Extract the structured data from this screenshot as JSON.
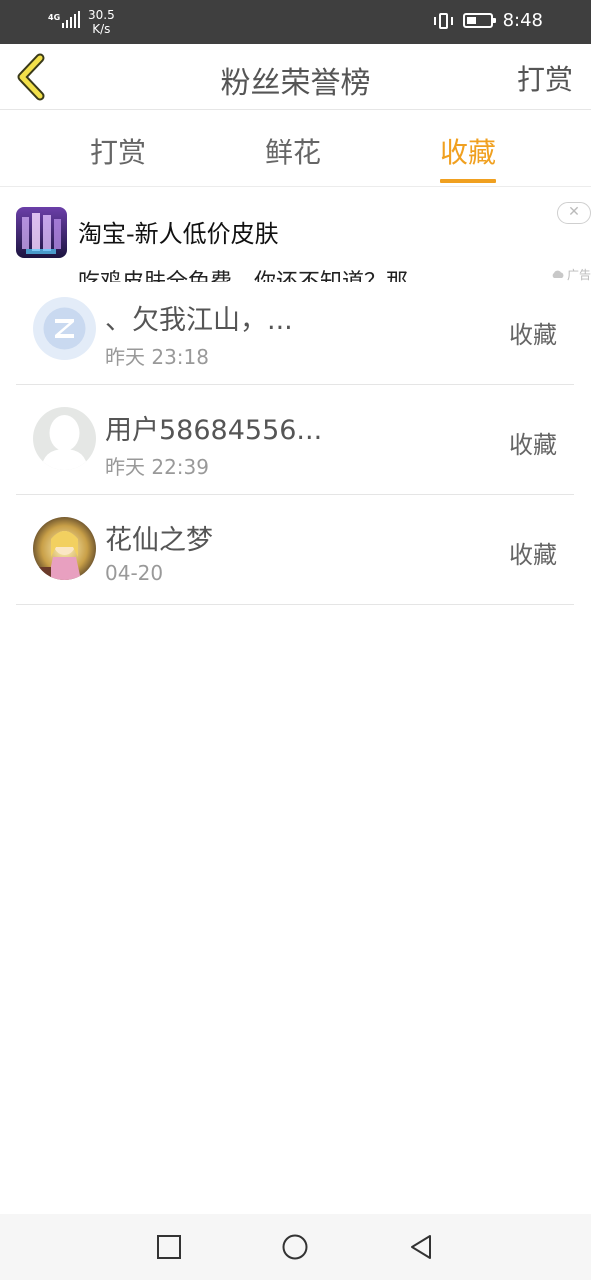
{
  "status_bar": {
    "network_type": "4G",
    "speed_value": "30.5",
    "speed_unit": "K/s",
    "battery_level": 0.4,
    "time": "8:48",
    "icons": [
      "signal-icon",
      "vibrate-icon",
      "battery-icon"
    ]
  },
  "header": {
    "title": "粉丝荣誉榜",
    "action_label": "打赏",
    "back_icon": "chevron-left-icon",
    "accent_color": "#f0a020"
  },
  "tabs": [
    {
      "label": "打赏",
      "active": false
    },
    {
      "label": "鲜花",
      "active": false
    },
    {
      "label": "收藏",
      "active": true
    }
  ],
  "ad": {
    "title": "淘宝-新人低价皮肤",
    "description": "吃鸡皮肤全免费，你还不知道？那",
    "label": "广告",
    "close_icon": "close-icon"
  },
  "list": [
    {
      "name": "、欠我江山，...",
      "time": "昨天 23:18",
      "action": "收藏",
      "avatar": "qq-logo-avatar"
    },
    {
      "name": "用户58684556...",
      "time": "昨天 22:39",
      "action": "收藏",
      "avatar": "default-silhouette-avatar"
    },
    {
      "name": "花仙之梦",
      "time": "04-20",
      "action": "收藏",
      "avatar": "anime-girl-avatar"
    }
  ],
  "nav_bar": {
    "icons": [
      "recent-apps-icon",
      "home-icon",
      "back-icon"
    ]
  }
}
